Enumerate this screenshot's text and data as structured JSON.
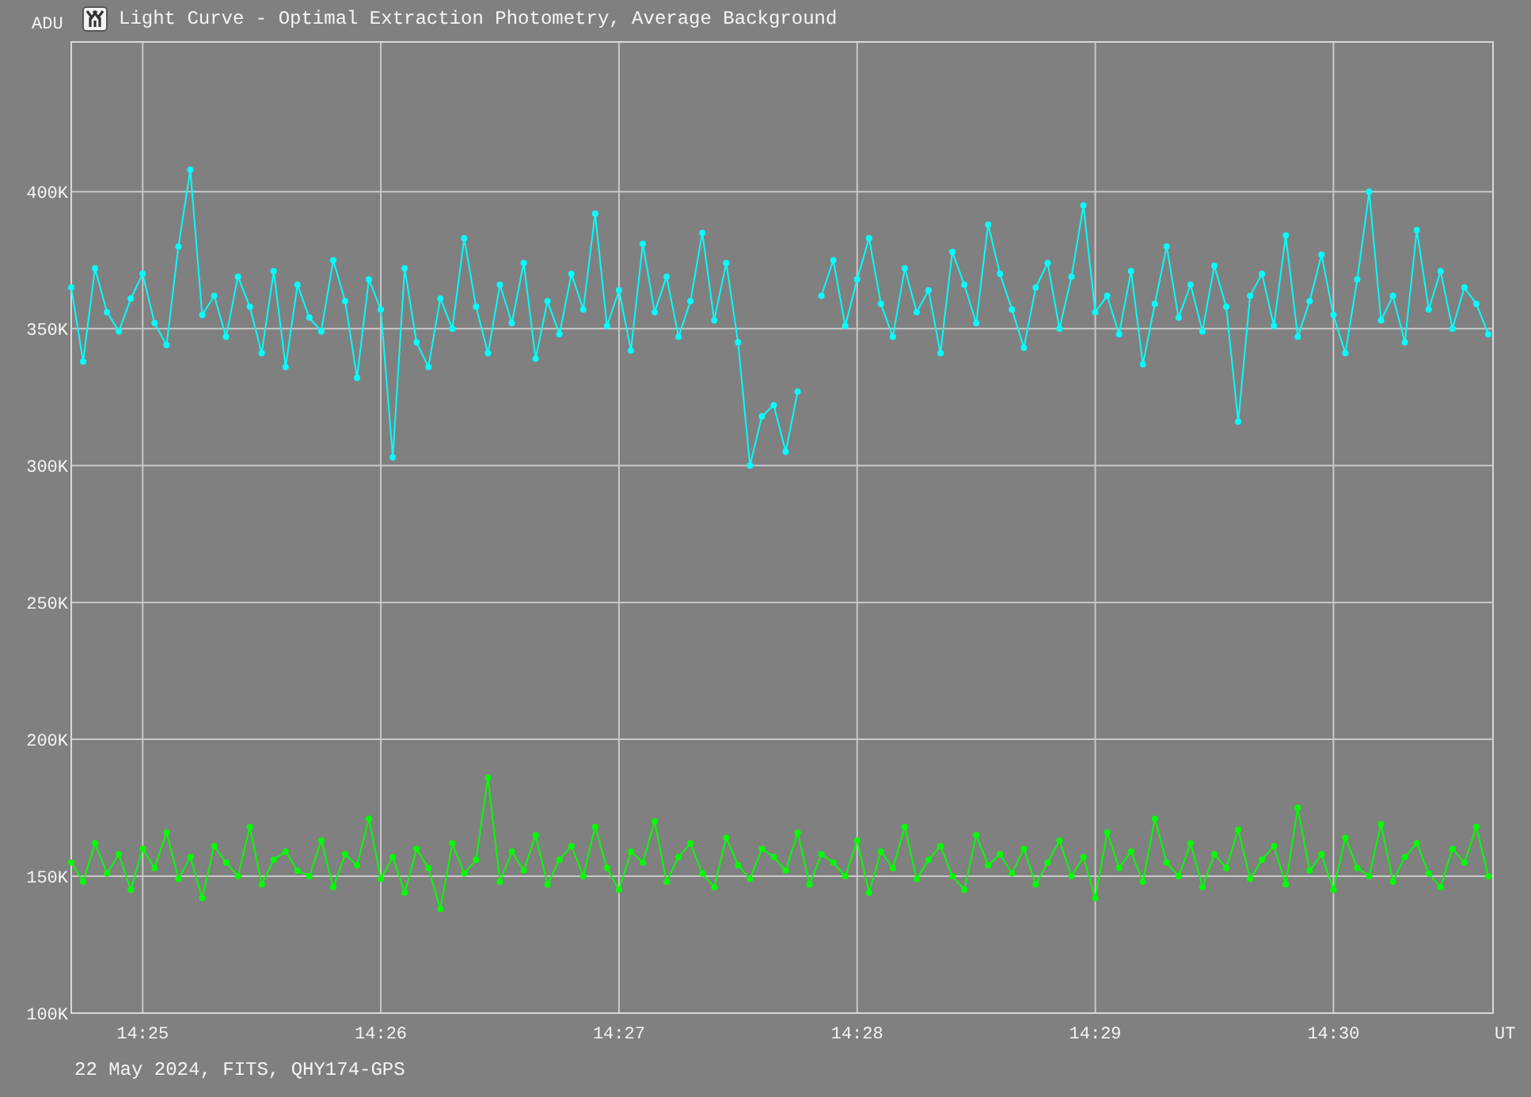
{
  "window": {
    "title": "Light Curve - Optimal Extraction Photometry, Average Background"
  },
  "plot": {
    "chart_data": {
      "type": "line",
      "xlabel": "UT",
      "ylabel": "ADU",
      "categories": [
        null,
        null,
        null,
        null,
        null,
        null,
        "14:25",
        null,
        null,
        null,
        null,
        null,
        null,
        null,
        null,
        null,
        null,
        null,
        null,
        null,
        null,
        null,
        null,
        null,
        null,
        null,
        "14:26",
        null,
        null,
        null,
        null,
        null,
        null,
        null,
        null,
        null,
        null,
        null,
        null,
        null,
        null,
        null,
        null,
        null,
        null,
        null,
        "14:27",
        null,
        null,
        null,
        null,
        null,
        null,
        null,
        null,
        null,
        null,
        null,
        null,
        null,
        null,
        null,
        null,
        null,
        null,
        null,
        "14:28",
        null,
        null,
        null,
        null,
        null,
        null,
        null,
        null,
        null,
        null,
        null,
        null,
        null,
        null,
        null,
        null,
        null,
        null,
        null,
        "14:29",
        null,
        null,
        null,
        null,
        null,
        null,
        null,
        null,
        null,
        null,
        null,
        null,
        null,
        null,
        null,
        null,
        null,
        null,
        null,
        "14:30",
        null,
        null,
        null,
        null,
        null,
        null,
        null,
        null,
        null,
        null,
        null,
        null,
        null
      ],
      "grid": true,
      "series": [
        {
          "color": "#00ffff",
          "marker": "circle",
          "values": [
            365000,
            338000,
            372000,
            356000,
            349000,
            361000,
            370000,
            352000,
            344000,
            380000,
            408000,
            355000,
            362000,
            347000,
            369000,
            358000,
            341000,
            371000,
            336000,
            366000,
            354000,
            349000,
            375000,
            360000,
            332000,
            368000,
            357000,
            303000,
            372000,
            345000,
            336000,
            361000,
            350000,
            383000,
            358000,
            341000,
            366000,
            352000,
            374000,
            339000,
            360000,
            348000,
            370000,
            357000,
            392000,
            351000,
            364000,
            342000,
            381000,
            356000,
            369000,
            347000,
            360000,
            385000,
            353000,
            374000,
            345000,
            300000,
            318000,
            322000,
            305000,
            327000,
            null,
            362000,
            375000,
            351000,
            368000,
            383000,
            359000,
            347000,
            372000,
            356000,
            364000,
            341000,
            378000,
            366000,
            352000,
            388000,
            370000,
            357000,
            343000,
            365000,
            374000,
            350000,
            369000,
            395000,
            356000,
            362000,
            348000,
            371000,
            337000,
            359000,
            380000,
            354000,
            366000,
            349000,
            373000,
            358000,
            316000,
            362000,
            370000,
            351000,
            384000,
            347000,
            360000,
            377000,
            355000,
            341000,
            368000,
            400000,
            353000,
            362000,
            345000,
            386000,
            357000,
            371000,
            350000,
            365000,
            359000,
            348000
          ]
        },
        {
          "color": "#00ff00",
          "marker": "circle",
          "values": [
            155000,
            148000,
            162000,
            151000,
            158000,
            145000,
            160000,
            153000,
            166000,
            149000,
            157000,
            142000,
            161000,
            155000,
            150000,
            168000,
            147000,
            156000,
            159000,
            152000,
            150000,
            163000,
            146000,
            158000,
            154000,
            171000,
            149000,
            157000,
            144000,
            160000,
            153000,
            138000,
            162000,
            151000,
            156000,
            186000,
            148000,
            159000,
            152000,
            165000,
            147000,
            156000,
            161000,
            150000,
            168000,
            153000,
            145000,
            159000,
            155000,
            170000,
            148000,
            157000,
            162000,
            151000,
            146000,
            164000,
            154000,
            149000,
            160000,
            157000,
            152000,
            166000,
            147000,
            158000,
            155000,
            150000,
            163000,
            144000,
            159000,
            153000,
            168000,
            149000,
            156000,
            161000,
            150000,
            145000,
            165000,
            154000,
            158000,
            151000,
            160000,
            147000,
            155000,
            163000,
            150000,
            157000,
            142000,
            166000,
            153000,
            159000,
            148000,
            171000,
            155000,
            150000,
            162000,
            146000,
            158000,
            153000,
            167000,
            149000,
            156000,
            161000,
            147000,
            175000,
            152000,
            158000,
            145000,
            164000,
            153000,
            150000,
            169000,
            148000,
            157000,
            162000,
            151000,
            146000,
            160000,
            155000,
            168000,
            150000
          ]
        }
      ],
      "ylim": [
        100000,
        455000
      ],
      "yticks": [
        {
          "value": 400000,
          "label": "400K"
        },
        {
          "value": 350000,
          "label": "350K"
        },
        {
          "value": 300000,
          "label": "300K"
        },
        {
          "value": 250000,
          "label": "250K"
        },
        {
          "value": 200000,
          "label": "200K"
        },
        {
          "value": 150000,
          "label": "150K"
        },
        {
          "value": 100000,
          "label": "100K"
        }
      ]
    }
  },
  "footer": "22 May 2024, FITS, QHY174-GPS"
}
